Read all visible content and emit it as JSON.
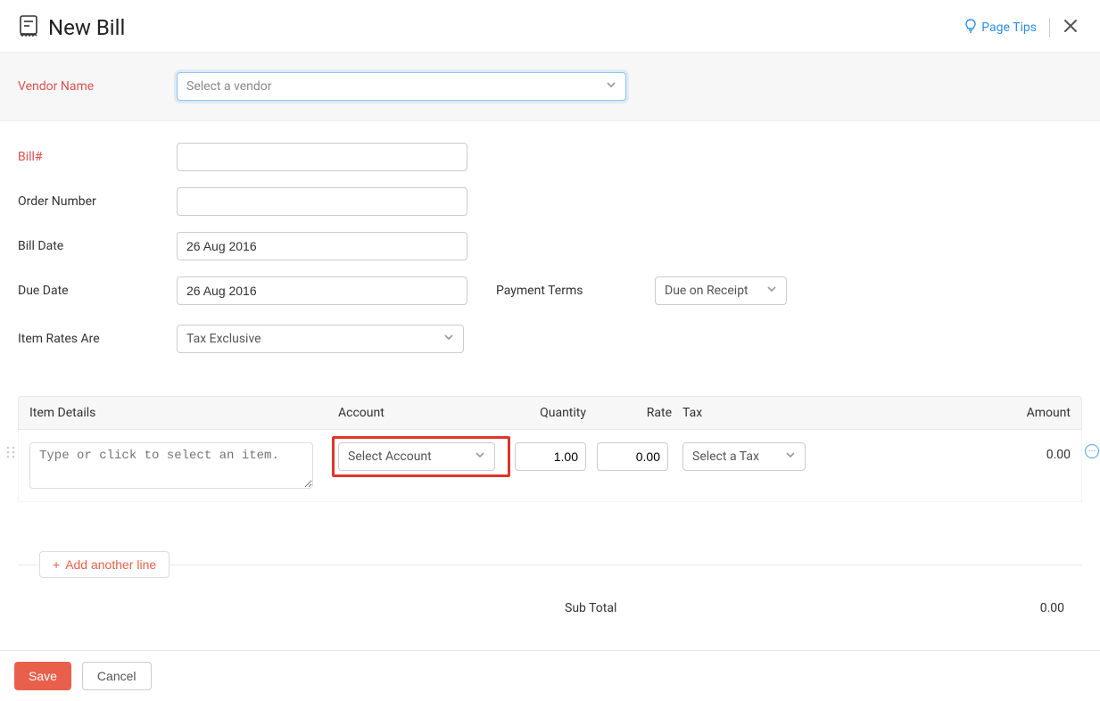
{
  "header": {
    "title": "New Bill",
    "page_tips": "Page Tips"
  },
  "vendor": {
    "label": "Vendor Name",
    "placeholder": "Select a vendor"
  },
  "fields": {
    "bill_no": {
      "label": "Bill#",
      "value": ""
    },
    "order_no": {
      "label": "Order Number",
      "value": ""
    },
    "bill_date": {
      "label": "Bill Date",
      "value": "26 Aug 2016"
    },
    "due_date": {
      "label": "Due Date",
      "value": "26 Aug 2016"
    },
    "payment_terms": {
      "label": "Payment Terms",
      "value": "Due on Receipt"
    },
    "item_rates": {
      "label": "Item Rates Are",
      "value": "Tax Exclusive"
    }
  },
  "columns": {
    "item": "Item Details",
    "account": "Account",
    "quantity": "Quantity",
    "rate": "Rate",
    "tax": "Tax",
    "amount": "Amount"
  },
  "row": {
    "item_placeholder": "Type or click to select an item.",
    "account_placeholder": "Select Account",
    "quantity": "1.00",
    "rate": "0.00",
    "tax_placeholder": "Select a Tax",
    "amount": "0.00"
  },
  "actions": {
    "add_line": "Add another line",
    "save": "Save",
    "cancel": "Cancel"
  },
  "totals": {
    "subtotal_label": "Sub Total",
    "subtotal_value": "0.00"
  }
}
